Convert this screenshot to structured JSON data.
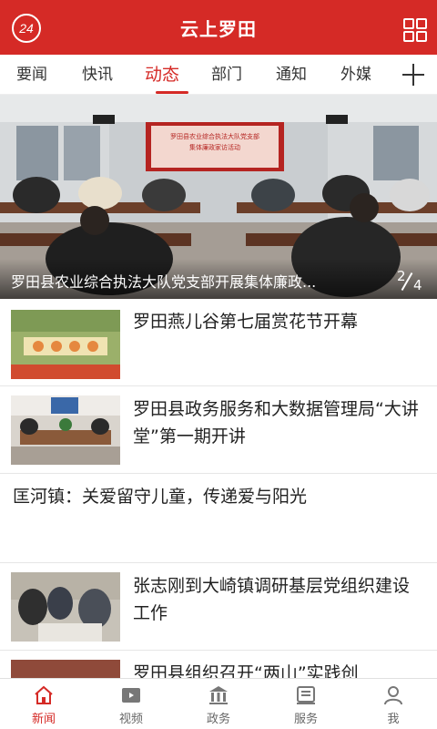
{
  "header": {
    "logo_text": "24",
    "title": "云上罗田"
  },
  "tabs": [
    {
      "label": "要闻",
      "active": false
    },
    {
      "label": "快讯",
      "active": false
    },
    {
      "label": "动态",
      "active": true
    },
    {
      "label": "部门",
      "active": false
    },
    {
      "label": "通知",
      "active": false
    },
    {
      "label": "外媒",
      "active": false
    }
  ],
  "banner": {
    "caption": "罗田县农业综合执法大队党支部开展集体廉政...",
    "current": "2",
    "total": "4",
    "screen_title": "罗田县农业综合执法大队党支部",
    "screen_subtitle": "集体廉政家访活动"
  },
  "news": [
    {
      "title": "罗田燕儿谷第七届赏花节开幕",
      "has_thumb": true
    },
    {
      "title": "罗田县政务服务和大数据管理局“大讲堂”第一期开讲",
      "has_thumb": true
    },
    {
      "title": "匡河镇：关爱留守儿童，传递爱与阳光",
      "has_thumb": false
    },
    {
      "title": "张志刚到大崎镇调研基层党组织建设工作",
      "has_thumb": true
    },
    {
      "title": "罗田县组织召开“两山”实践创",
      "has_thumb": true
    }
  ],
  "bottom_nav": [
    {
      "label": "新闻",
      "icon": "home-icon",
      "active": true
    },
    {
      "label": "视频",
      "icon": "video-icon",
      "active": false
    },
    {
      "label": "政务",
      "icon": "government-icon",
      "active": false
    },
    {
      "label": "服务",
      "icon": "service-icon",
      "active": false
    },
    {
      "label": "我",
      "icon": "profile-icon",
      "active": false
    }
  ],
  "colors": {
    "brand": "#d52a26",
    "text": "#222222",
    "inactive_nav": "#666666"
  }
}
